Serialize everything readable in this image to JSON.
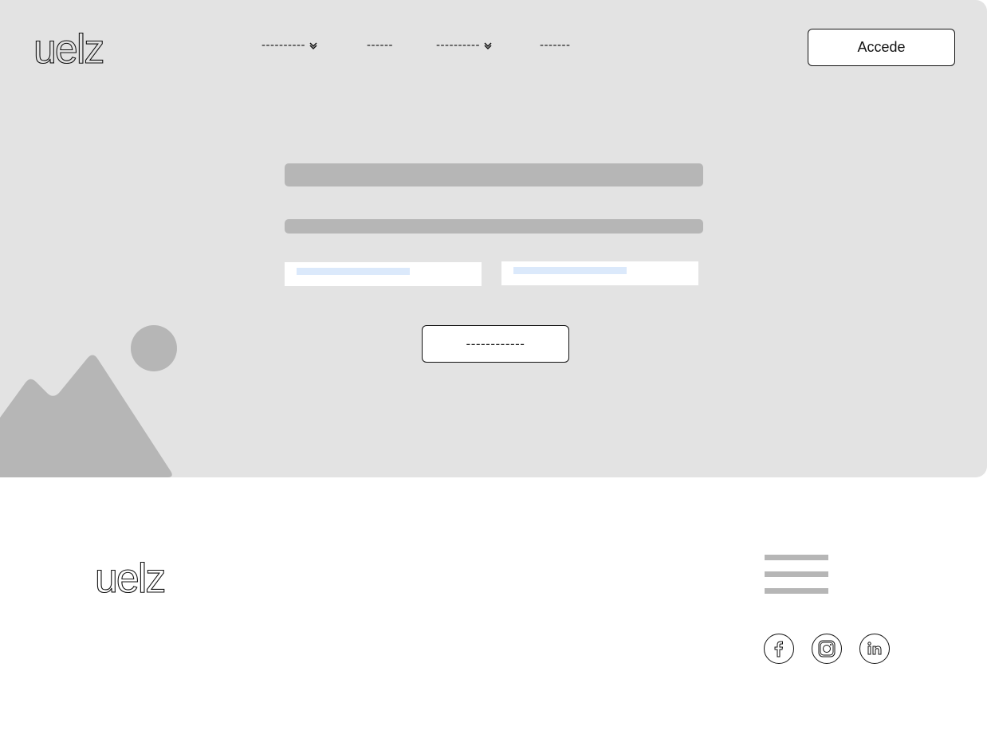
{
  "header": {
    "logo_text": "uelz",
    "nav": [
      {
        "label": "----------",
        "has_dropdown": true
      },
      {
        "label": "------",
        "has_dropdown": false
      },
      {
        "label": "----------",
        "has_dropdown": true
      },
      {
        "label": "-------",
        "has_dropdown": false
      }
    ],
    "login_label": "Accede"
  },
  "hero": {
    "cta_label": "------------"
  },
  "footer": {
    "logo_text": "uelz",
    "social_icons": [
      "facebook-icon",
      "instagram-icon",
      "linkedin-icon"
    ]
  },
  "colors": {
    "hero_bg": "#e3e3e3",
    "placeholder_bar": "#b6b6b6",
    "input_placeholder": "#dbe9fb"
  }
}
